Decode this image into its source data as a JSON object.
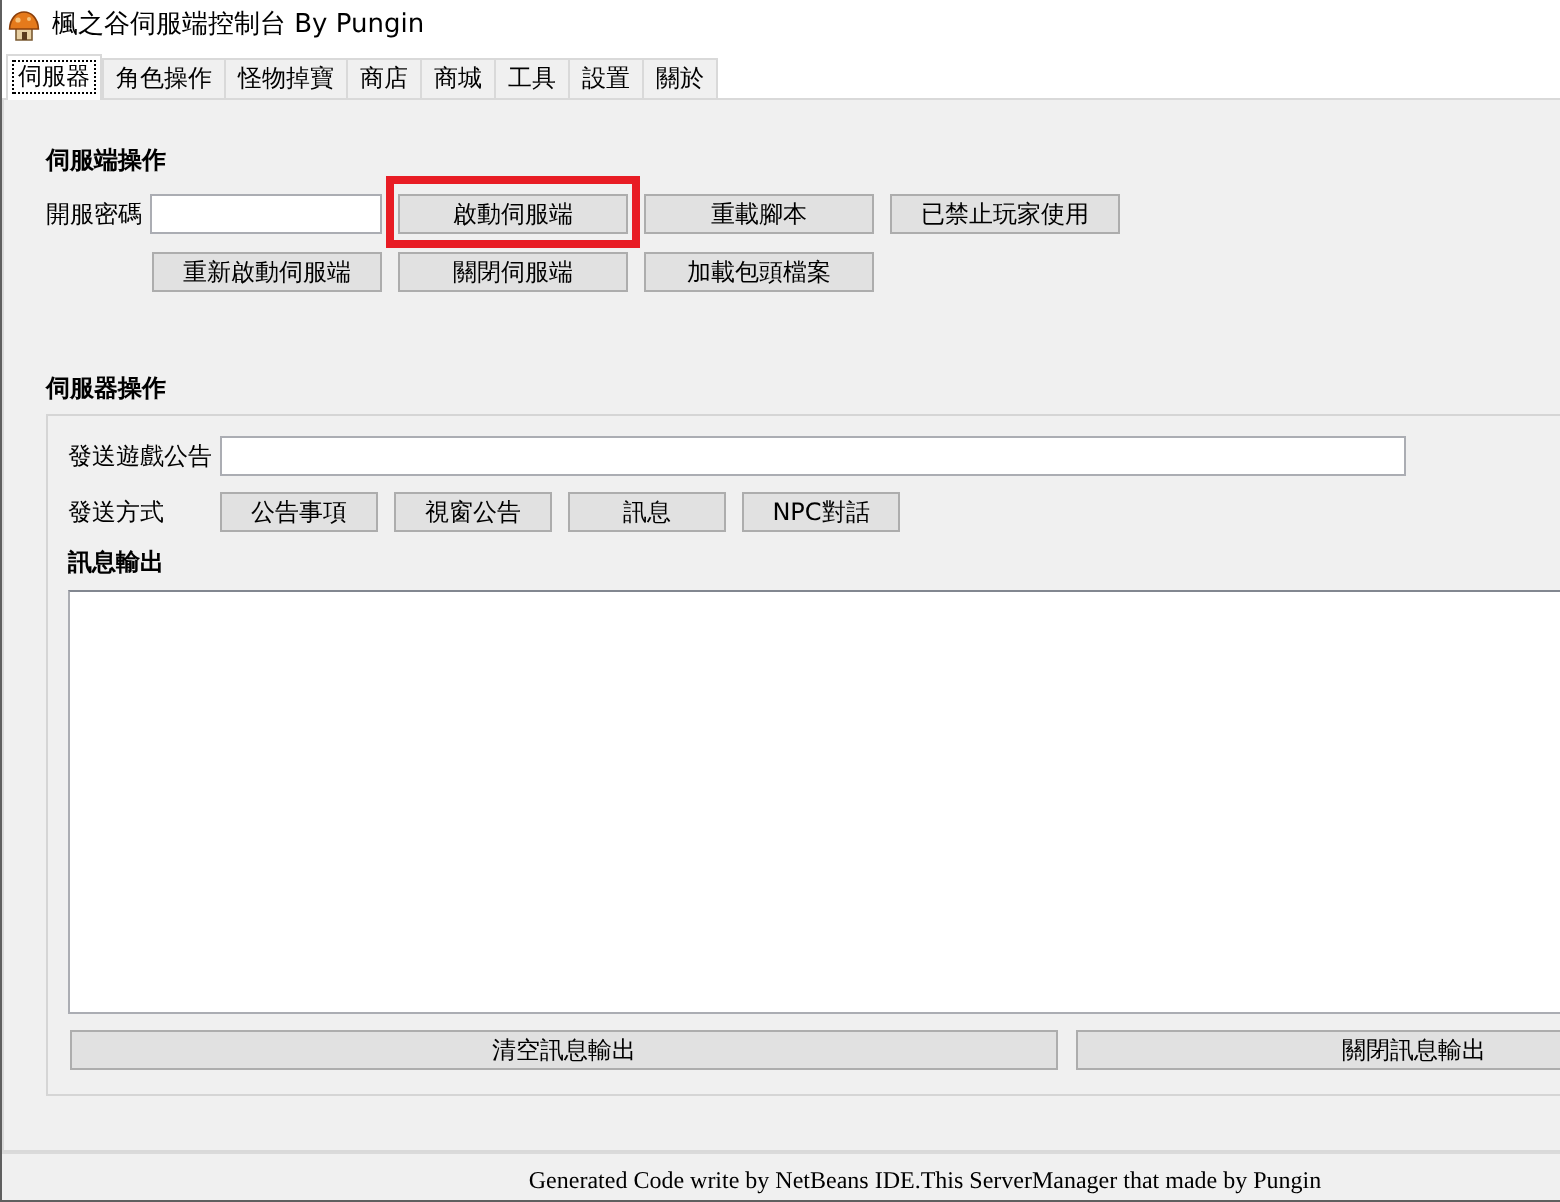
{
  "window": {
    "title": "楓之谷伺服端控制台 By Pungin"
  },
  "tabs": [
    {
      "label": "伺服器",
      "selected": true
    },
    {
      "label": "角色操作",
      "selected": false
    },
    {
      "label": "怪物掉寶",
      "selected": false
    },
    {
      "label": "商店",
      "selected": false
    },
    {
      "label": "商城",
      "selected": false
    },
    {
      "label": "工具",
      "selected": false
    },
    {
      "label": "設置",
      "selected": false
    },
    {
      "label": "關於",
      "selected": false
    }
  ],
  "server_side": {
    "heading": "伺服端操作",
    "password_label": "開服密碼",
    "button_rows": [
      [
        {
          "label": "啟動伺服端",
          "highlighted": true
        },
        {
          "label": "重載腳本",
          "highlighted": false
        },
        {
          "label": "已禁止玩家使用",
          "highlighted": false
        }
      ],
      [
        {
          "label": "重新啟動伺服端",
          "highlighted": false
        },
        {
          "label": "關閉伺服端",
          "highlighted": false
        },
        {
          "label": "加載包頭檔案",
          "highlighted": false
        }
      ]
    ]
  },
  "server_ops": {
    "heading": "伺服器操作",
    "announcement_label": "發送遊戲公告",
    "send_mode_label": "發送方式",
    "send_modes": [
      "公告事項",
      "視窗公告",
      "訊息",
      "NPC對話"
    ],
    "output_label": "訊息輸出",
    "output_buttons": [
      "清空訊息輸出",
      "關閉訊息輸出"
    ]
  },
  "status_bar": {
    "text": "Generated Code write by NetBeans IDE.This ServerManager that made by Pungin"
  }
}
